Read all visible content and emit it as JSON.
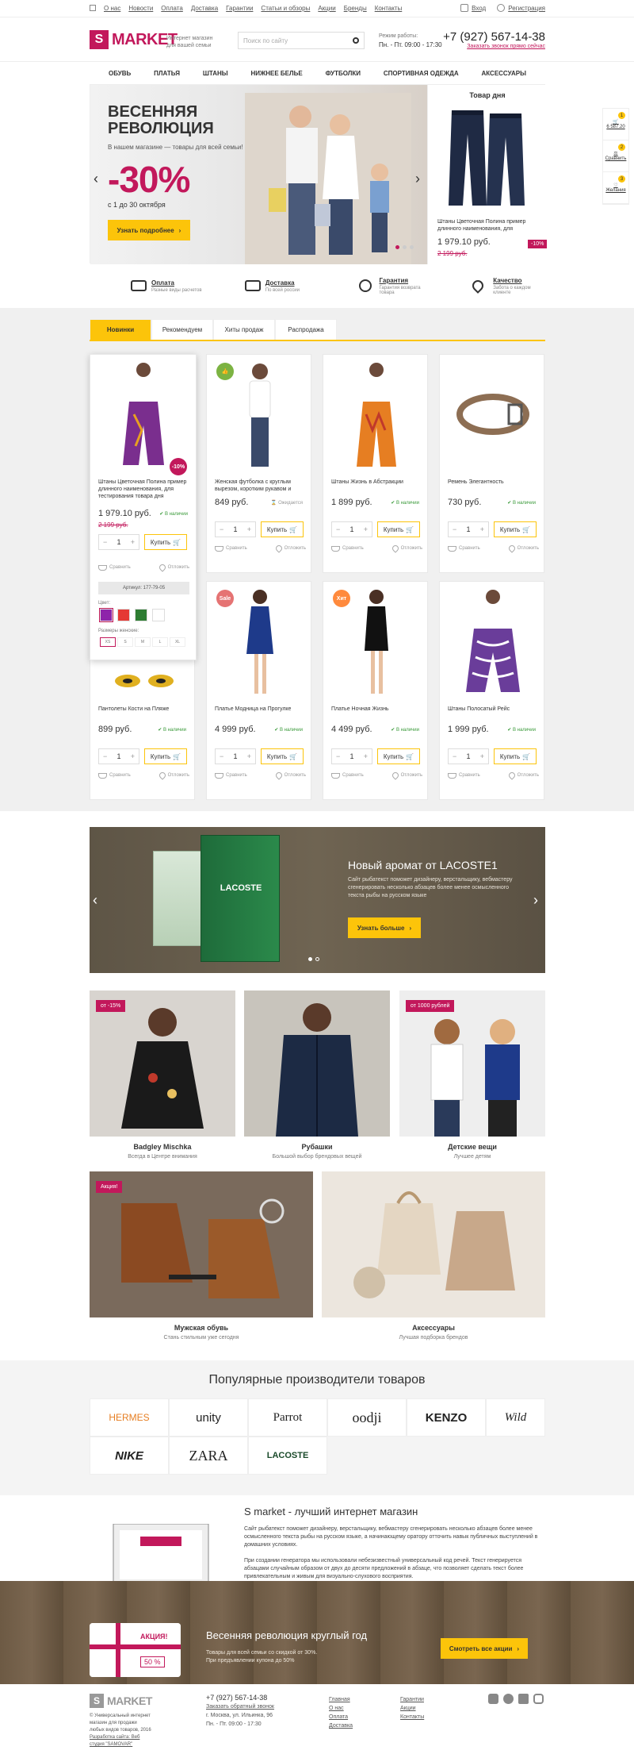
{
  "topbar": {
    "links": [
      "О нас",
      "Новости",
      "Оплата",
      "Доставка",
      "Гарантии",
      "Статьи и обзоры",
      "Акции",
      "Бренды",
      "Контакты"
    ],
    "login": "Вход",
    "register": "Регистрация"
  },
  "header": {
    "logo_letter": "S",
    "logo_text": "MARKET",
    "tagline": "Интернет магазин для вашей семьи",
    "search_placeholder": "Поиск по сайту",
    "hours_label": "Режим работы:",
    "hours": "Пн. - Пт. 09:00 - 17:30",
    "phone": "+7 (927) 567-14-38",
    "callback": "Заказать звонок прямо сейчас"
  },
  "nav": [
    "ОБУВЬ",
    "ПЛАТЬЯ",
    "ШТАНЫ",
    "НИЖНЕЕ БЕЛЬЕ",
    "ФУТБОЛКИ",
    "СПОРТИВНАЯ ОДЕЖДА",
    "АКСЕССУАРЫ"
  ],
  "hero": {
    "title_1": "ВЕСЕННЯЯ",
    "title_2": "РЕВОЛЮЦИЯ",
    "sub": "В нашем магазине — товары для всей семьи!",
    "discount": "-30%",
    "until": "с 1 до 30 октября",
    "button": "Узнать подробнее"
  },
  "deal": {
    "heading": "Товар дня",
    "name": "Штаны Цветочная Полина пример длинного наименования, для",
    "price": "1 979.10 руб.",
    "old": "2 199 руб.",
    "badge": "-10%"
  },
  "side": {
    "cart_count": "1",
    "cart_sum": "6 587.20",
    "compare_count": "2",
    "compare_label": "Сравнить",
    "fav_count": "3",
    "fav_label": "Желания"
  },
  "features": [
    {
      "title": "Оплата",
      "desc": "Разные виды расчетов"
    },
    {
      "title": "Доставка",
      "desc": "По всей россии"
    },
    {
      "title": "Гарантия",
      "desc": "Гарантия возврата товара"
    },
    {
      "title": "Качество",
      "desc": "Забота о каждом клиенте"
    }
  ],
  "tabs": [
    "Новинки",
    "Рекомендуем",
    "Хиты продаж",
    "Распродажа"
  ],
  "labels": {
    "buy": "Купить",
    "compare": "Сравнить",
    "favorite": "Отложить",
    "qty": "1",
    "color": "Цвет:",
    "size": "Размеры женские:"
  },
  "expanded": {
    "article": "Артикул: 177-79-05",
    "sizes": [
      "XS",
      "S",
      "M",
      "L",
      "XL"
    ]
  },
  "products": [
    {
      "name": "Штаны Цветочная Полина пример длинного наименования, для тестирования товара дня",
      "price": "1 979.10 руб.",
      "old": "2 199 руб.",
      "stock": "В наличии",
      "badge": "-10%"
    },
    {
      "name": "Женская футболка с круглым вырезом, коротким рукавом и",
      "price": "849 руб.",
      "old": "",
      "stock": "Ожидается",
      "badge": ""
    },
    {
      "name": "Штаны Жизнь в Абстракции",
      "price": "1 899 руб.",
      "old": "",
      "stock": "В наличии",
      "badge": ""
    },
    {
      "name": "Ремень Элегантность",
      "price": "730 руб.",
      "old": "",
      "stock": "В наличии",
      "badge": ""
    },
    {
      "name": "Пантолеты Кости на Пляже",
      "price": "899 руб.",
      "old": "",
      "stock": "В наличии",
      "badge": ""
    },
    {
      "name": "Платье Модница на Прогулке",
      "price": "4 999 руб.",
      "old": "",
      "stock": "В наличии",
      "badge": "Sale"
    },
    {
      "name": "Платье Ночная Жизнь",
      "price": "4 499 руб.",
      "old": "",
      "stock": "В наличии",
      "badge": "Хит"
    },
    {
      "name": "Штаны Полосатый Рейс",
      "price": "1 999 руб.",
      "old": "",
      "stock": "В наличии",
      "badge": ""
    }
  ],
  "banner2": {
    "title": "Новый аромат от LACOSTE1",
    "desc": "Сайт рыбатекст поможет дизайнеру, верстальщику, вебмастеру сгенерировать несколько абзацев более менее осмысленного текста рыбы на русском языке",
    "button": "Узнать больше",
    "brand": "LACOSTE"
  },
  "categories": [
    {
      "title": "Badgley Mischka",
      "sub": "Всегда в Центре внимания",
      "tag": "от -15%"
    },
    {
      "title": "Рубашки",
      "sub": "Большой выбор брендовых вещей",
      "tag": ""
    },
    {
      "title": "Детские вещи",
      "sub": "Лучшее детям",
      "tag": "от 1000 рублей"
    },
    {
      "title": "Мужская обувь",
      "sub": "Стань стильным уже сегодня",
      "tag": "Акция!"
    },
    {
      "title": "Аксессуары",
      "sub": "Лучшая подборка брендов",
      "tag": ""
    }
  ],
  "brands_heading": "Популярные производители товаров",
  "brands": [
    "HERMES",
    "unity",
    "Parrot",
    "oodji",
    "KENZO",
    "Wild",
    "NIKE",
    "ZARA",
    "LACOSTE"
  ],
  "about": {
    "title": "S market - лучший интернет магазин",
    "p1": "Сайт рыбатекст поможет дизайнеру, верстальщику, вебмастеру сгенерировать несколько абзацев более менее осмысленного текста рыбы на русском языке, а начинающему оратору отточить навык публичных выступлений в домашних условиях.",
    "p2": "При создании генератора мы использовали небезизвестный универсальный код речей. Текст генерируется абзацами случайным образом от двух до десяти предложений в абзаце, что позволяет сделать текст более привлекательным и живым для визуально-слухового восприятия."
  },
  "promo": {
    "title": "Весенняя революция круглый год",
    "p1": "Товары для всей семьи со скидкой от 30%.",
    "p2": "При предъявлении купона до 50%",
    "button": "Смотреть все акции",
    "card_label": "АКЦИЯ!",
    "card_pct": "50 %"
  },
  "footer": {
    "copy": "© Универсальный интернет магазин для продажи любых видов товаров, 2016",
    "studio": "Разработка сайта: Веб студия \"SAMOVAR\"",
    "phone": "+7 (927) 567-14-38",
    "callback": "Заказать обратный звонок",
    "address": "г. Москва, ул. Ильинка, 96",
    "hours": "Пн. - Пт. 09:00 - 17:30",
    "col1": [
      "Главная",
      "О нас",
      "Оплата",
      "Доставка"
    ],
    "col2": [
      "Гарантии",
      "Акции",
      "Контакты"
    ]
  }
}
